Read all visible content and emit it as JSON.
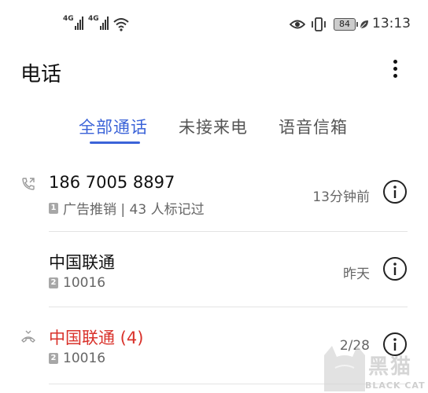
{
  "status_bar": {
    "sim1_tag": "4G",
    "sim2_tag": "4G",
    "battery_level": "84",
    "time": "13:13",
    "icons": [
      "signal-icon",
      "wifi-icon",
      "eye-comfort-icon",
      "vibrate-icon",
      "battery-icon",
      "power-saving-leaf-icon"
    ]
  },
  "header": {
    "title": "电话"
  },
  "tabs": [
    {
      "label": "全部通话",
      "active": true
    },
    {
      "label": "未接来电",
      "active": false
    },
    {
      "label": "语音信箱",
      "active": false
    }
  ],
  "calls": [
    {
      "type": "outgoing",
      "name": "186 7005 8897",
      "sim": "1",
      "detail": "广告推销 | 43 人标记过",
      "when": "13分钟前",
      "missed": false
    },
    {
      "type": "outgoing",
      "name": "中国联通",
      "sim": "2",
      "detail": "10016",
      "when": "昨天",
      "missed": false
    },
    {
      "type": "missed",
      "name": "中国联通 (4)",
      "sim": "2",
      "detail": "10016",
      "when": "2/28",
      "missed": true
    }
  ],
  "watermark": {
    "text": "黑猫",
    "subtext": "BLACK CAT"
  },
  "colors": {
    "accent": "#3b63d8",
    "missed": "#d9322b",
    "secondary_text": "#666666"
  }
}
